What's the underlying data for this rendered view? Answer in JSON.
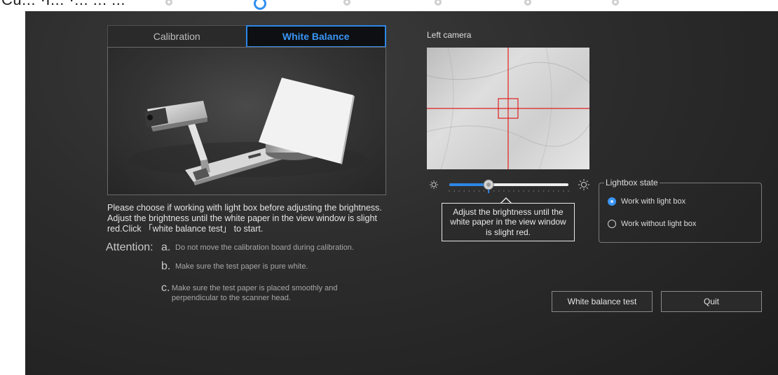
{
  "header": {
    "ghost_text": "Cu... ·I... ·... ... ..."
  },
  "tabs": [
    {
      "label": "Calibration",
      "active": false
    },
    {
      "label": "White Balance",
      "active": true
    }
  ],
  "description": "Please choose if working with light box before adjusting the brightness. Adjust the brightness until the white paper in the view window is slight red.Click 「white balance test」 to start.",
  "attention": {
    "label": "Attention:",
    "items": [
      {
        "letter": "a.",
        "text": "Do not move the calibration board during calibration."
      },
      {
        "letter": "b.",
        "text": "Make sure the test paper is pure white."
      },
      {
        "letter": "c.",
        "text": "Make sure the test paper is placed smoothly and perpendicular to the scanner head."
      }
    ]
  },
  "camera": {
    "label": "Left camera"
  },
  "brightness": {
    "value_fraction": 0.33,
    "tooltip": "Adjust the brightness until the white paper in the view window is slight red."
  },
  "lightbox": {
    "title": "Lightbox state",
    "options": [
      {
        "label": "Work with light box",
        "checked": true
      },
      {
        "label": "Work without light box",
        "checked": false
      }
    ]
  },
  "buttons": {
    "white_balance_test": "White balance test",
    "quit": "Quit"
  },
  "colors": {
    "accent": "#2d86e6",
    "crosshair": "#e02020"
  },
  "icons": {
    "brightness_low": "sun-small-icon",
    "brightness_high": "sun-large-icon"
  }
}
